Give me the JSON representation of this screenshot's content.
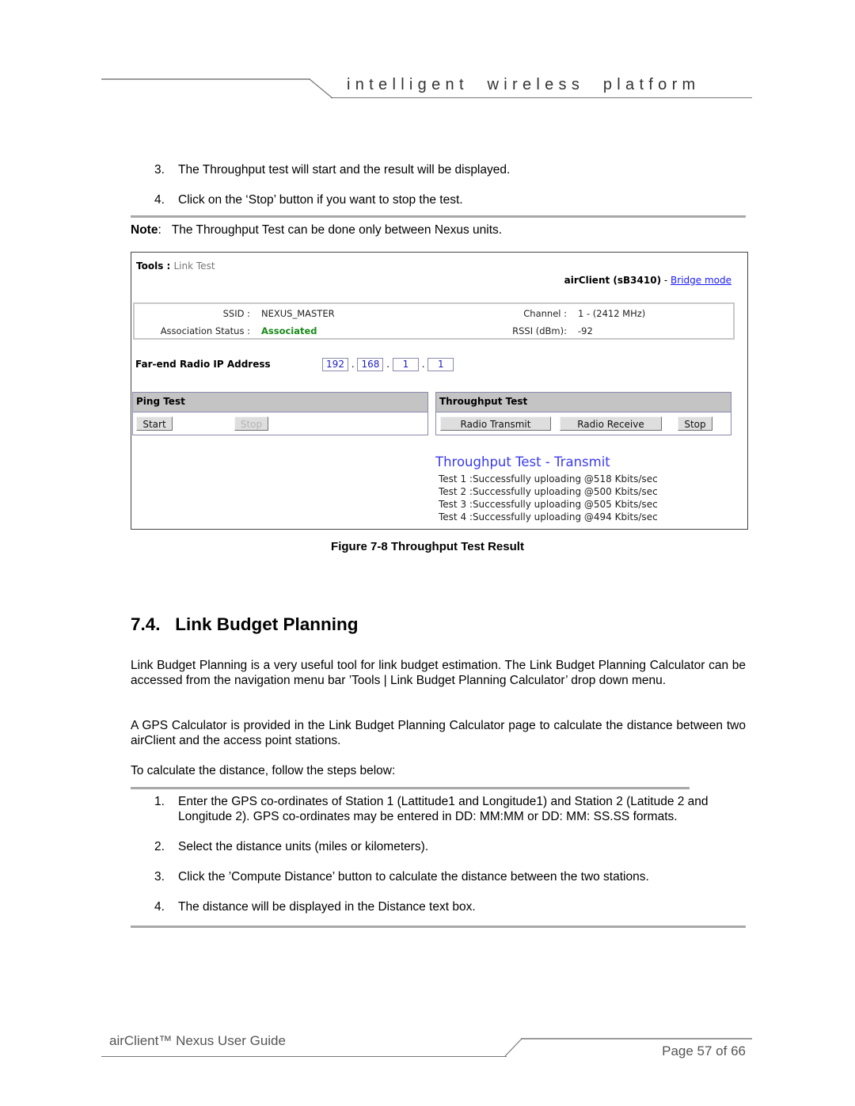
{
  "header": {
    "tagline": "intelligent  wireless  platform"
  },
  "steps_top": [
    {
      "num": "3.",
      "text": "The Throughput test will start and the result will be displayed."
    },
    {
      "num": "4.",
      "text": "Click on the ‘Stop’ button if you want to stop the test."
    }
  ],
  "note": {
    "label": "Note",
    "text": "The Throughput Test can be done only between Nexus units."
  },
  "screenshot": {
    "breadcrumb_main": "Tools : ",
    "breadcrumb_sub": "Link Test",
    "device_name": "airClient (sB3410)",
    "device_sep": " - ",
    "device_mode_link": "Bridge mode",
    "ssid_label": "SSID :",
    "ssid_value": "NEXUS_MASTER",
    "assoc_label": "Association Status :",
    "assoc_value": "Associated",
    "channel_label": "Channel :",
    "channel_value": "1 - (2412 MHz)",
    "rssi_label": "RSSI (dBm):",
    "rssi_value": "-92",
    "ip_label": "Far-end Radio IP Address",
    "ip_octets": [
      "192",
      "168",
      "1",
      "1"
    ],
    "ping_test": {
      "title": "Ping Test",
      "start_label": "Start",
      "stop_label": "Stop"
    },
    "throughput_test": {
      "title": "Throughput Test",
      "transmit_label": "Radio Transmit",
      "receive_label": "Radio Receive",
      "stop_label": "Stop"
    },
    "results": {
      "title": "Throughput Test - Transmit",
      "lines": [
        "Test 1 :Successfully uploading @518 Kbits/sec",
        "Test 2 :Successfully uploading @500 Kbits/sec",
        "Test 3 :Successfully uploading @505 Kbits/sec",
        "Test 4 :Successfully uploading @494 Kbits/sec"
      ]
    }
  },
  "figure_caption": "Figure 7-8 Throughput Test Result",
  "section": {
    "title": "7.4.   Link Budget Planning",
    "paragraphs": [
      "Link Budget Planning is a very useful tool for link budget estimation. The Link Budget Planning Calculator can be accessed from the navigation menu bar ’Tools | Link Budget Planning Calculator’ drop down menu.",
      "A GPS Calculator is provided in the Link Budget Planning Calculator page to calculate the distance between two airClient and the access point stations.",
      "To calculate the distance, follow the steps below:"
    ],
    "steps": [
      {
        "num": "1.",
        "text": "Enter the GPS co-ordinates of Station 1 (Lattitude1 and Longitude1) and Station 2 (Latitude 2 and Longitude 2). GPS co-ordinates may be entered in DD: MM:MM or DD: MM: SS.SS formats."
      },
      {
        "num": "2.",
        "text": "Select the distance units (miles or kilometers)."
      },
      {
        "num": "3.",
        "text": "Click the ’Compute Distance’ button to calculate the distance between the two stations."
      },
      {
        "num": "4.",
        "text": "The distance will be displayed in the Distance text box."
      }
    ]
  },
  "footer": {
    "title": "airClient™ Nexus User Guide",
    "page": "Page 57 of 66"
  }
}
